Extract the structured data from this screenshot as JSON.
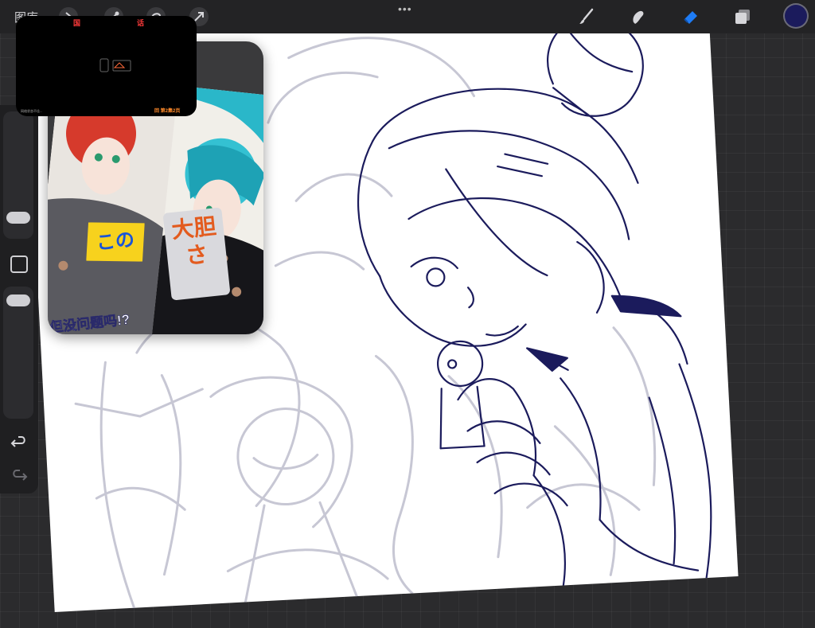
{
  "app": {
    "gallery_label": "图库",
    "toolbar": {
      "left_tools": [
        "actions-icon",
        "adjustments-icon",
        "selection-icon",
        "transform-icon"
      ],
      "right_tools": [
        "brush-icon",
        "smudge-icon",
        "eraser-icon",
        "layers-icon",
        "color-icon"
      ],
      "more_label": "•••"
    },
    "colors": {
      "active_tool": "#1e7cf5",
      "current_color": "#1b1b5c",
      "ink": "#1b1b5c",
      "sketch": "#c7c7d4",
      "canvas_bg": "#2b2b2d"
    },
    "sidebar": {
      "brush_size_label": "brush-size-slider",
      "opacity_label": "opacity-slider",
      "modify_label": "modify-button",
      "undo_label": "undo-icon",
      "redo_label": "redo-icon"
    }
  },
  "reference": {
    "kono_text": "この",
    "big_text": "大胆さ",
    "subtitle": "但没问题吗!?"
  },
  "video_overlay": {
    "badge_left": "国",
    "badge_right": "话",
    "caption_left": "网络状态不佳...",
    "caption_right": "回 第2集2页"
  }
}
